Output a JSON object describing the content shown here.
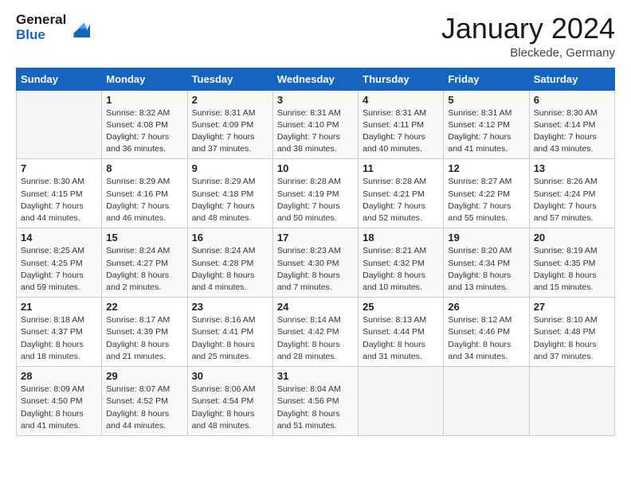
{
  "header": {
    "logo_line1": "General",
    "logo_line2": "Blue",
    "title": "January 2024",
    "subtitle": "Bleckede, Germany"
  },
  "weekdays": [
    "Sunday",
    "Monday",
    "Tuesday",
    "Wednesday",
    "Thursday",
    "Friday",
    "Saturday"
  ],
  "weeks": [
    [
      {
        "day": "",
        "info": ""
      },
      {
        "day": "1",
        "info": "Sunrise: 8:32 AM\nSunset: 4:08 PM\nDaylight: 7 hours\nand 36 minutes."
      },
      {
        "day": "2",
        "info": "Sunrise: 8:31 AM\nSunset: 4:09 PM\nDaylight: 7 hours\nand 37 minutes."
      },
      {
        "day": "3",
        "info": "Sunrise: 8:31 AM\nSunset: 4:10 PM\nDaylight: 7 hours\nand 38 minutes."
      },
      {
        "day": "4",
        "info": "Sunrise: 8:31 AM\nSunset: 4:11 PM\nDaylight: 7 hours\nand 40 minutes."
      },
      {
        "day": "5",
        "info": "Sunrise: 8:31 AM\nSunset: 4:12 PM\nDaylight: 7 hours\nand 41 minutes."
      },
      {
        "day": "6",
        "info": "Sunrise: 8:30 AM\nSunset: 4:14 PM\nDaylight: 7 hours\nand 43 minutes."
      }
    ],
    [
      {
        "day": "7",
        "info": "Sunrise: 8:30 AM\nSunset: 4:15 PM\nDaylight: 7 hours\nand 44 minutes."
      },
      {
        "day": "8",
        "info": "Sunrise: 8:29 AM\nSunset: 4:16 PM\nDaylight: 7 hours\nand 46 minutes."
      },
      {
        "day": "9",
        "info": "Sunrise: 8:29 AM\nSunset: 4:18 PM\nDaylight: 7 hours\nand 48 minutes."
      },
      {
        "day": "10",
        "info": "Sunrise: 8:28 AM\nSunset: 4:19 PM\nDaylight: 7 hours\nand 50 minutes."
      },
      {
        "day": "11",
        "info": "Sunrise: 8:28 AM\nSunset: 4:21 PM\nDaylight: 7 hours\nand 52 minutes."
      },
      {
        "day": "12",
        "info": "Sunrise: 8:27 AM\nSunset: 4:22 PM\nDaylight: 7 hours\nand 55 minutes."
      },
      {
        "day": "13",
        "info": "Sunrise: 8:26 AM\nSunset: 4:24 PM\nDaylight: 7 hours\nand 57 minutes."
      }
    ],
    [
      {
        "day": "14",
        "info": "Sunrise: 8:25 AM\nSunset: 4:25 PM\nDaylight: 7 hours\nand 59 minutes."
      },
      {
        "day": "15",
        "info": "Sunrise: 8:24 AM\nSunset: 4:27 PM\nDaylight: 8 hours\nand 2 minutes."
      },
      {
        "day": "16",
        "info": "Sunrise: 8:24 AM\nSunset: 4:28 PM\nDaylight: 8 hours\nand 4 minutes."
      },
      {
        "day": "17",
        "info": "Sunrise: 8:23 AM\nSunset: 4:30 PM\nDaylight: 8 hours\nand 7 minutes."
      },
      {
        "day": "18",
        "info": "Sunrise: 8:21 AM\nSunset: 4:32 PM\nDaylight: 8 hours\nand 10 minutes."
      },
      {
        "day": "19",
        "info": "Sunrise: 8:20 AM\nSunset: 4:34 PM\nDaylight: 8 hours\nand 13 minutes."
      },
      {
        "day": "20",
        "info": "Sunrise: 8:19 AM\nSunset: 4:35 PM\nDaylight: 8 hours\nand 15 minutes."
      }
    ],
    [
      {
        "day": "21",
        "info": "Sunrise: 8:18 AM\nSunset: 4:37 PM\nDaylight: 8 hours\nand 18 minutes."
      },
      {
        "day": "22",
        "info": "Sunrise: 8:17 AM\nSunset: 4:39 PM\nDaylight: 8 hours\nand 21 minutes."
      },
      {
        "day": "23",
        "info": "Sunrise: 8:16 AM\nSunset: 4:41 PM\nDaylight: 8 hours\nand 25 minutes."
      },
      {
        "day": "24",
        "info": "Sunrise: 8:14 AM\nSunset: 4:42 PM\nDaylight: 8 hours\nand 28 minutes."
      },
      {
        "day": "25",
        "info": "Sunrise: 8:13 AM\nSunset: 4:44 PM\nDaylight: 8 hours\nand 31 minutes."
      },
      {
        "day": "26",
        "info": "Sunrise: 8:12 AM\nSunset: 4:46 PM\nDaylight: 8 hours\nand 34 minutes."
      },
      {
        "day": "27",
        "info": "Sunrise: 8:10 AM\nSunset: 4:48 PM\nDaylight: 8 hours\nand 37 minutes."
      }
    ],
    [
      {
        "day": "28",
        "info": "Sunrise: 8:09 AM\nSunset: 4:50 PM\nDaylight: 8 hours\nand 41 minutes."
      },
      {
        "day": "29",
        "info": "Sunrise: 8:07 AM\nSunset: 4:52 PM\nDaylight: 8 hours\nand 44 minutes."
      },
      {
        "day": "30",
        "info": "Sunrise: 8:06 AM\nSunset: 4:54 PM\nDaylight: 8 hours\nand 48 minutes."
      },
      {
        "day": "31",
        "info": "Sunrise: 8:04 AM\nSunset: 4:56 PM\nDaylight: 8 hours\nand 51 minutes."
      },
      {
        "day": "",
        "info": ""
      },
      {
        "day": "",
        "info": ""
      },
      {
        "day": "",
        "info": ""
      }
    ]
  ]
}
